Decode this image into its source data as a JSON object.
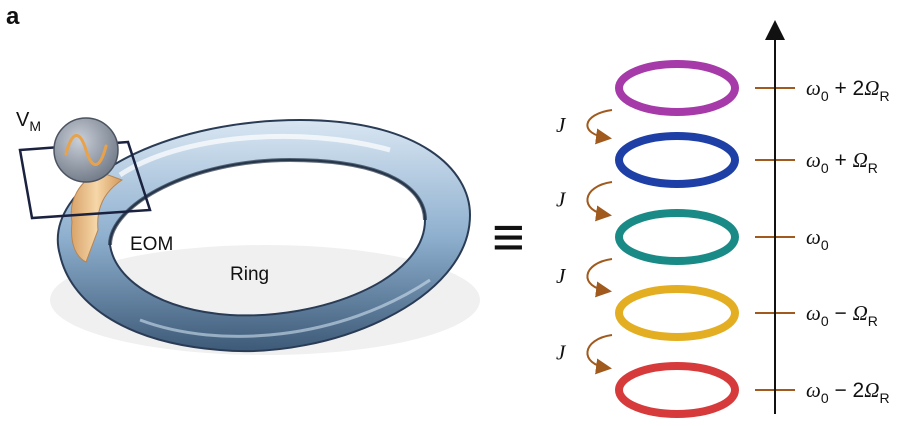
{
  "panel_label": "a",
  "ring_label": "Ring",
  "eom_label": "EOM",
  "vm_label": {
    "base": "V",
    "sub": "M"
  },
  "equiv_symbol": "≡",
  "coupling_label": "J",
  "ring_colors": [
    "#a53aa8",
    "#1e3fa6",
    "#1a8a86",
    "#e4ae22",
    "#d63a3a"
  ],
  "ring_body_color": "#9fbbd6",
  "eom_color": "#f0c890",
  "coupling_arrow_color": "#a05a1e",
  "frequency_levels": [
    {
      "sym": "ω",
      "sub": "0",
      "op": " + 2",
      "sym2": "Ω",
      "sub2": "R"
    },
    {
      "sym": "ω",
      "sub": "0",
      "op": " + ",
      "sym2": "Ω",
      "sub2": "R"
    },
    {
      "sym": "ω",
      "sub": "0",
      "op": "",
      "sym2": "",
      "sub2": ""
    },
    {
      "sym": "ω",
      "sub": "0",
      "op": " − ",
      "sym2": "Ω",
      "sub2": "R"
    },
    {
      "sym": "ω",
      "sub": "0",
      "op": " − 2",
      "sym2": "Ω",
      "sub2": "R"
    }
  ]
}
